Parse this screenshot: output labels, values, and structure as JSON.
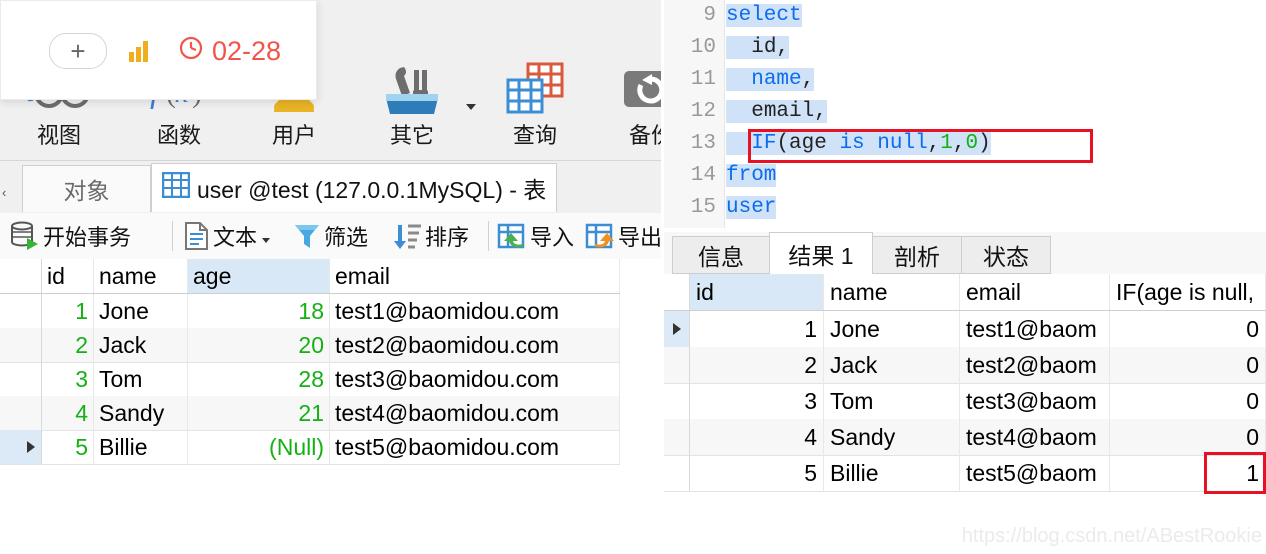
{
  "ribbon": {
    "items": [
      {
        "label": "视图",
        "icon": "view-glasses-icon"
      },
      {
        "label": "函数",
        "icon": "function-fx-icon"
      },
      {
        "label": "用户",
        "icon": "user-icon"
      },
      {
        "label": "其它",
        "icon": "other-toolbox-icon"
      },
      {
        "label": "查询",
        "icon": "query-grid-icon"
      },
      {
        "label": "备份",
        "icon": "backup-restore-icon"
      }
    ]
  },
  "tabstrip": {
    "object_tab": "对象",
    "table_tab": "user @test (127.0.0.1MySQL) - 表",
    "table_tab_icon": "table-grid-icon"
  },
  "data_toolbar": {
    "buttons": [
      {
        "label": "开始事务",
        "icon": "begin-transaction-icon"
      },
      {
        "label": "文本",
        "icon": "text-document-icon",
        "has_dropdown": true
      },
      {
        "label": "筛选",
        "icon": "filter-funnel-icon"
      },
      {
        "label": "排序",
        "icon": "sort-arrow-icon"
      },
      {
        "label": "导入",
        "icon": "import-icon"
      },
      {
        "label": "导出",
        "icon": "export-icon"
      }
    ]
  },
  "table_grid": {
    "columns": [
      "id",
      "name",
      "age",
      "email"
    ],
    "highlighted_column": "age",
    "selected_row_index": 4,
    "rows": [
      {
        "id": "1",
        "name": "Jone",
        "age": "18",
        "email": "test1@baomidou.com",
        "age_is_null": false
      },
      {
        "id": "2",
        "name": "Jack",
        "age": "20",
        "email": "test2@baomidou.com",
        "age_is_null": false
      },
      {
        "id": "3",
        "name": "Tom",
        "age": "28",
        "email": "test3@baomidou.com",
        "age_is_null": false
      },
      {
        "id": "4",
        "name": "Sandy",
        "age": "21",
        "email": "test4@baomidou.com",
        "age_is_null": false
      },
      {
        "id": "5",
        "name": "Billie",
        "age": "(Null)",
        "email": "test5@baomidou.com",
        "age_is_null": true
      }
    ]
  },
  "sql_editor": {
    "lines": [
      {
        "number": "9",
        "indent": 0,
        "tokens": [
          {
            "t": "select",
            "c": "kw"
          }
        ]
      },
      {
        "number": "10",
        "indent": 2,
        "tokens": [
          {
            "t": "id,",
            "c": "pl"
          }
        ]
      },
      {
        "number": "11",
        "indent": 2,
        "tokens": [
          {
            "t": "name",
            "c": "kw"
          },
          {
            "t": ",",
            "c": "pl"
          }
        ]
      },
      {
        "number": "12",
        "indent": 2,
        "tokens": [
          {
            "t": "email,",
            "c": "pl"
          }
        ]
      },
      {
        "number": "13",
        "indent": 2,
        "tokens": [
          {
            "t": "IF",
            "c": "kw"
          },
          {
            "t": "(age ",
            "c": "pl"
          },
          {
            "t": "is null",
            "c": "kw"
          },
          {
            "t": ",",
            "c": "pl"
          },
          {
            "t": "1",
            "c": "num"
          },
          {
            "t": ",",
            "c": "pl"
          },
          {
            "t": "0",
            "c": "num"
          },
          {
            "t": ")",
            "c": "pl"
          }
        ]
      },
      {
        "number": "14",
        "indent": 0,
        "tokens": [
          {
            "t": "from",
            "c": "kw"
          }
        ]
      },
      {
        "number": "15",
        "indent": 0,
        "tokens": [
          {
            "t": "user",
            "c": "kw"
          }
        ]
      }
    ],
    "annotated_line_number": "13",
    "selection_color": "#cfe2f7",
    "annotation_color": "#e81123"
  },
  "result_tabs": {
    "tabs": [
      "信息",
      "结果 1",
      "剖析",
      "状态"
    ],
    "active_index": 1
  },
  "result_grid": {
    "columns": [
      "id",
      "name",
      "email",
      "IF(age is null,"
    ],
    "highlighted_column": "id",
    "selected_row_index": 0,
    "annotated_cell": {
      "row_index": 4,
      "column_index": 3
    },
    "rows": [
      {
        "id": "1",
        "name": "Jone",
        "email": "test1@baom",
        "if_value": "0"
      },
      {
        "id": "2",
        "name": "Jack",
        "email": "test2@baom",
        "if_value": "0"
      },
      {
        "id": "3",
        "name": "Tom",
        "email": "test3@baom",
        "if_value": "0"
      },
      {
        "id": "4",
        "name": "Sandy",
        "email": "test4@baom",
        "if_value": "0"
      },
      {
        "id": "5",
        "name": "Billie",
        "email": "test5@baom",
        "if_value": "1"
      }
    ]
  },
  "overlay_popup": {
    "plus_label": "+",
    "chart_icon": "bar-chart-icon",
    "clock_icon": "clock-icon",
    "time_label": "02-28",
    "accent_color": "#f2544a"
  },
  "watermark": "https://blog.csdn.net/ABestRookie"
}
